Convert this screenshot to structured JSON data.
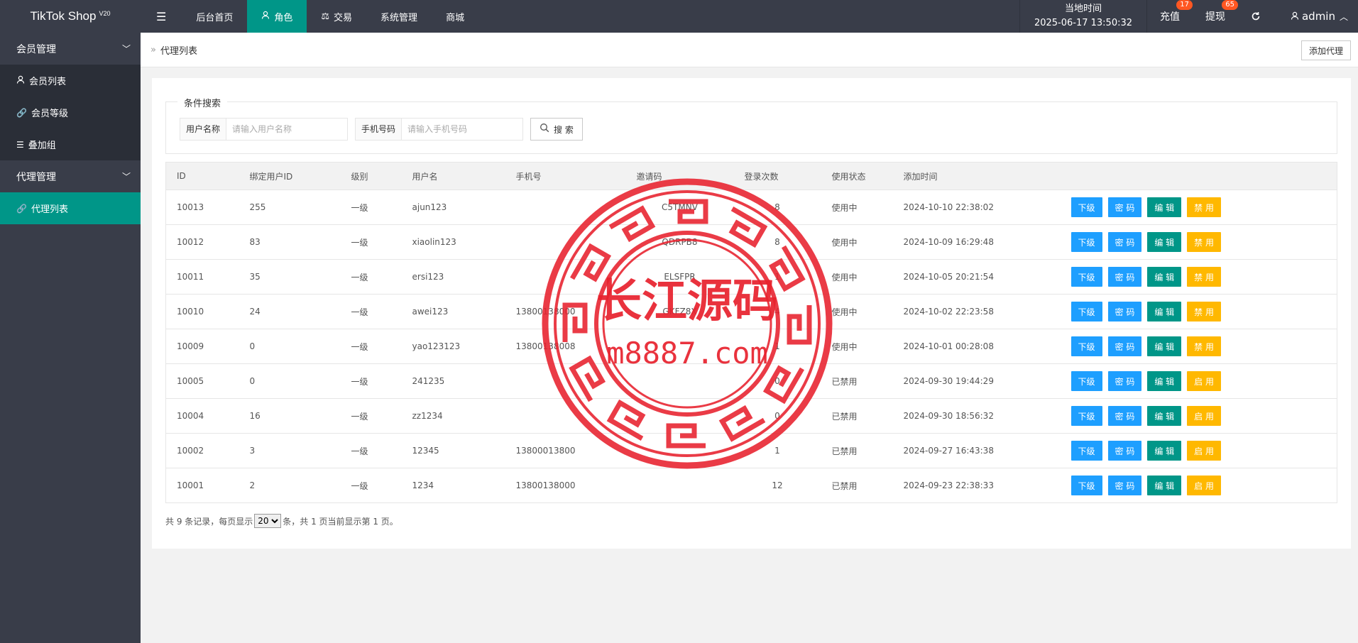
{
  "header": {
    "logo": "TikTok Shop",
    "logo_version": "V20",
    "menu_toggle": "☰",
    "nav": [
      {
        "label": "后台首页",
        "icon": "",
        "active": false
      },
      {
        "label": "角色",
        "icon": "user-icon",
        "active": true
      },
      {
        "label": "交易",
        "icon": "scale-icon",
        "active": false
      },
      {
        "label": "系统管理",
        "icon": "",
        "active": false
      },
      {
        "label": "商城",
        "icon": "",
        "active": false
      }
    ],
    "time_label": "当地时间",
    "time_value": "2025-06-17 13:50:32",
    "recharge_label": "充值",
    "recharge_badge": "17",
    "withdraw_label": "提现",
    "withdraw_badge": "65",
    "user": "admin"
  },
  "sidebar": {
    "groups": [
      {
        "label": "会员管理",
        "items": [
          {
            "label": "会员列表",
            "icon": "user-icon"
          },
          {
            "label": "会员等级",
            "icon": "link-icon"
          },
          {
            "label": "叠加组",
            "icon": "list-icon"
          }
        ]
      },
      {
        "label": "代理管理",
        "items": [
          {
            "label": "代理列表",
            "icon": "link-icon",
            "active": true
          }
        ]
      }
    ]
  },
  "breadcrumb": {
    "title": "代理列表",
    "add_button": "添加代理"
  },
  "search": {
    "legend": "条件搜索",
    "username_label": "用户名称",
    "username_placeholder": "请输入用户名称",
    "phone_label": "手机号码",
    "phone_placeholder": "请输入手机号码",
    "button": "搜 索"
  },
  "table": {
    "columns": [
      "ID",
      "绑定用户ID",
      "级别",
      "用户名",
      "手机号",
      "邀请码",
      "登录次数",
      "使用状态",
      "添加时间",
      ""
    ],
    "rows": [
      {
        "id": "10013",
        "bind": "255",
        "level": "一级",
        "user": "ajun123",
        "phone": "",
        "code": "C5TMNV",
        "logins": "8",
        "status": "使用中",
        "on": true,
        "time": "2024-10-10 22:38:02",
        "toggle": "禁 用"
      },
      {
        "id": "10012",
        "bind": "83",
        "level": "一级",
        "user": "xiaolin123",
        "phone": "",
        "code": "QDRPB8",
        "logins": "8",
        "status": "使用中",
        "on": true,
        "time": "2024-10-09 16:29:48",
        "toggle": "禁 用"
      },
      {
        "id": "10011",
        "bind": "35",
        "level": "一级",
        "user": "ersi123",
        "phone": "",
        "code": "ELSFPR",
        "logins": "1",
        "status": "使用中",
        "on": true,
        "time": "2024-10-05 20:21:54",
        "toggle": "禁 用"
      },
      {
        "id": "10010",
        "bind": "24",
        "level": "一级",
        "user": "awei123",
        "phone": "13800138000",
        "code": "GKFZ8X",
        "logins": "4",
        "status": "使用中",
        "on": true,
        "time": "2024-10-02 22:23:58",
        "toggle": "禁 用"
      },
      {
        "id": "10009",
        "bind": "0",
        "level": "一级",
        "user": "yao123123",
        "phone": "13800138008",
        "code": "",
        "logins": "1",
        "status": "使用中",
        "on": true,
        "time": "2024-10-01 00:28:08",
        "toggle": "禁 用"
      },
      {
        "id": "10005",
        "bind": "0",
        "level": "一级",
        "user": "241235",
        "phone": "",
        "code": "",
        "logins": "0",
        "status": "已禁用",
        "on": false,
        "time": "2024-09-30 19:44:29",
        "toggle": "启 用"
      },
      {
        "id": "10004",
        "bind": "16",
        "level": "一级",
        "user": "zz1234",
        "phone": "",
        "code": "",
        "logins": "0",
        "status": "已禁用",
        "on": false,
        "time": "2024-09-30 18:56:32",
        "toggle": "启 用"
      },
      {
        "id": "10002",
        "bind": "3",
        "level": "一级",
        "user": "12345",
        "phone": "13800013800",
        "code": "",
        "logins": "1",
        "status": "已禁用",
        "on": false,
        "time": "2024-09-27 16:43:38",
        "toggle": "启 用"
      },
      {
        "id": "10001",
        "bind": "2",
        "level": "一级",
        "user": "1234",
        "phone": "13800138000",
        "code": "",
        "logins": "12",
        "status": "已禁用",
        "on": false,
        "time": "2024-09-23 22:38:33",
        "toggle": "启 用"
      }
    ],
    "actions": {
      "sub": "下级",
      "pwd": "密 码",
      "edit": "编 辑"
    }
  },
  "pager": {
    "prefix": "共 9 条记录，每页显示",
    "page_size": "20",
    "suffix": "条，共 1 页当前显示第 1 页。"
  },
  "watermark": {
    "line1": "长江源码",
    "line2": "m8887.com"
  },
  "colors": {
    "header": "#393d49",
    "accent": "#009688",
    "blue": "#1e9fff",
    "yellow": "#ffb800",
    "danger": "#ff2d2d",
    "seal": "#e8212d"
  }
}
